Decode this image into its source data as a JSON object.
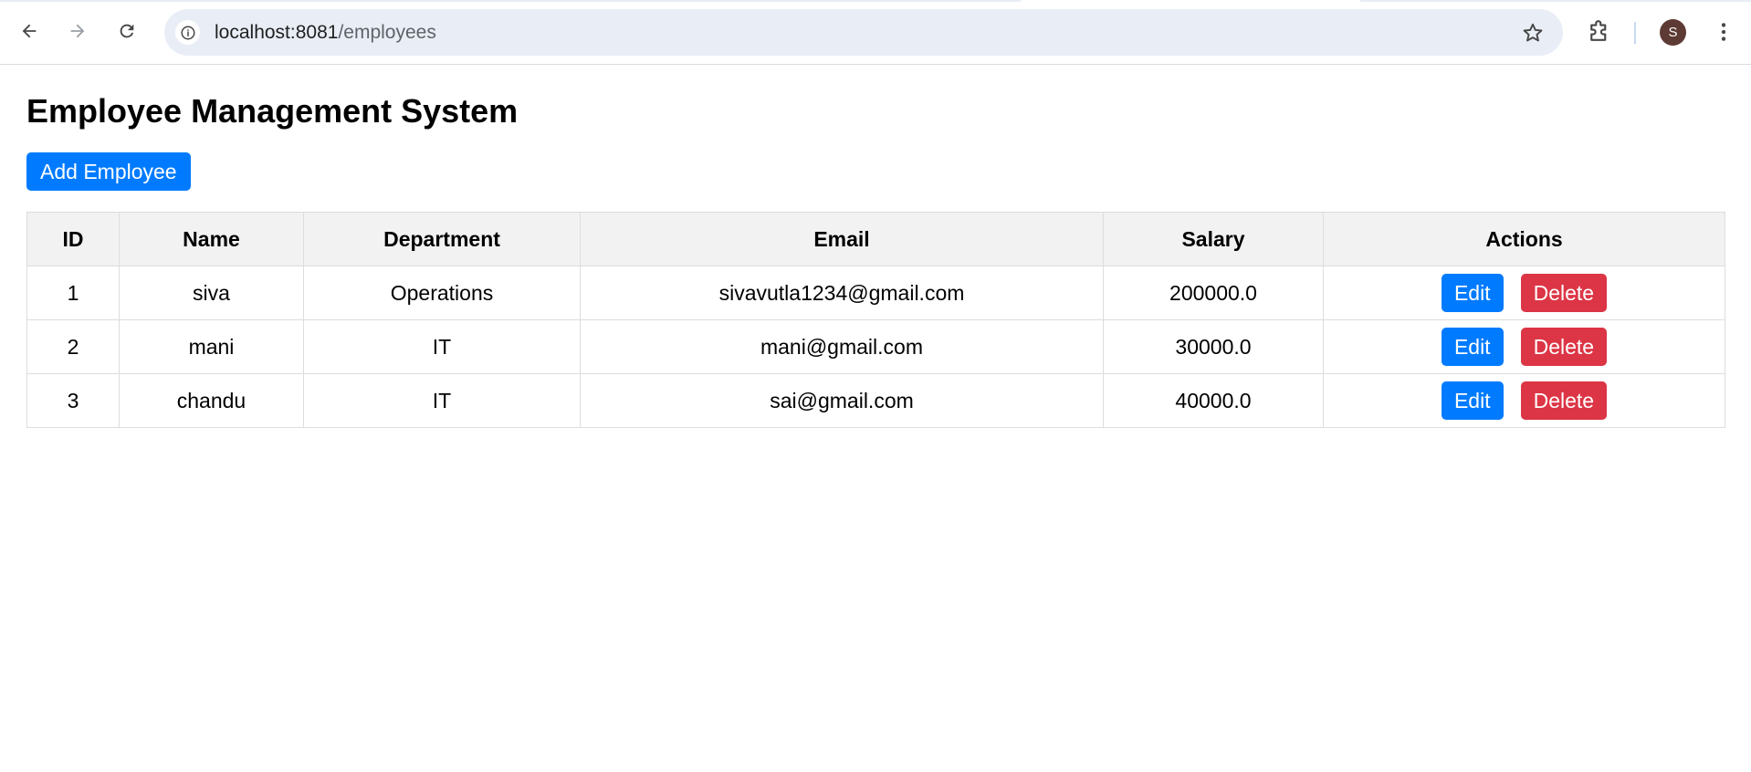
{
  "browser": {
    "url_host": "localhost:8081",
    "url_path": "/employees",
    "avatar_letter": "S",
    "icons": [
      "back-arrow-icon",
      "forward-arrow-icon",
      "reload-icon",
      "site-info-icon",
      "bookmark-star-icon",
      "extensions-puzzle-icon",
      "kebab-menu-icon"
    ]
  },
  "page": {
    "title": "Employee Management System",
    "add_button": "Add Employee"
  },
  "table": {
    "headers": [
      "ID",
      "Name",
      "Department",
      "Email",
      "Salary",
      "Actions"
    ],
    "rows": [
      {
        "id": "1",
        "name": "siva",
        "department": "Operations",
        "email": "sivavutla1234@gmail.com",
        "salary": "200000.0"
      },
      {
        "id": "2",
        "name": "mani",
        "department": "IT",
        "email": "mani@gmail.com",
        "salary": "30000.0"
      },
      {
        "id": "3",
        "name": "chandu",
        "department": "IT",
        "email": "sai@gmail.com",
        "salary": "40000.0"
      }
    ],
    "edit_label": "Edit",
    "delete_label": "Delete"
  },
  "colors": {
    "primary": "#007bff",
    "danger": "#dc3545",
    "header_bg": "#f2f2f2",
    "border": "#dddddd"
  }
}
